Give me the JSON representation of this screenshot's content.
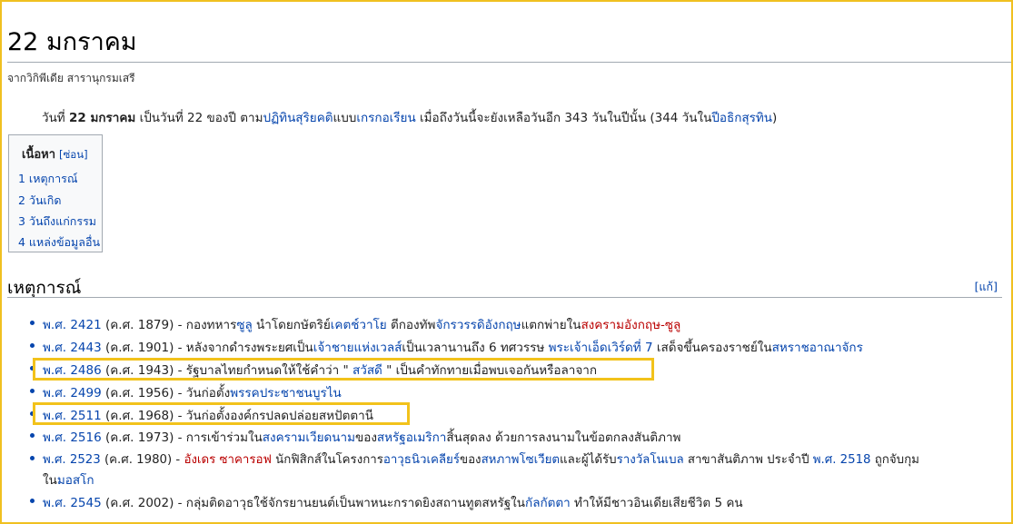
{
  "page": {
    "title": "22 มกราคม",
    "tagline": "จากวิกิพีเดีย สารานุกรมเสรี"
  },
  "intro": {
    "t1": "วันที่ ",
    "bold": "22 มกราคม",
    "t2": " เป็นวันที่ 22 ของปี ตาม",
    "link1": "ปฏิทินสุริยคติ",
    "t3": "แบบ",
    "link2": "เกรกอเรียน",
    "t4": " เมื่อถึงวันนี้จะยังเหลือวันอีก 343 วันในปีนั้น (344 วันใน",
    "link3": "ปีอธิกสุรทิน",
    "t5": ")"
  },
  "toc": {
    "title": "เนื้อหา",
    "hide": "[ซ่อน]",
    "items": [
      "1 เหตุการณ์",
      "2 วันเกิด",
      "3 วันถึงแก่กรรม",
      "4 แหล่งข้อมูลอื่น"
    ]
  },
  "section": {
    "heading": "เหตุการณ์",
    "edit": "[แก้]"
  },
  "events": [
    {
      "year": "พ.ศ. 2421",
      "ce": " (ค.ศ. 1879) - กองทหาร",
      "l1": "ซูลู",
      "a": " นำโดยกษัตริย์",
      "l2": "เคตช์วาโย",
      "b": " ตีกองทัพ",
      "l3": "จักรวรรดิอังกฤษ",
      "c": "แตกพ่ายใน",
      "r1": "สงครามอังกฤษ-ซูลู"
    },
    {
      "year": "พ.ศ. 2443",
      "ce": " (ค.ศ. 1901) - หลังจากดำรงพระยศเป็น",
      "l1": "เจ้าชายแห่งเวลส์",
      "a": "เป็นเวลานานถึง 6 ทศวรรษ ",
      "l2": "พระเจ้าเอ็ดเวิร์ดที่ 7",
      "b": " เสด็จขึ้นครองราชย์ใน",
      "l3": "สหราชอาณาจักร"
    },
    {
      "year": "พ.ศ. 2486",
      "ce": " (ค.ศ. 1943) - รัฐบาลไทยกำหนดให้ใช้คำว่า \" ",
      "l1": "สวัสดี",
      "a": " \" เป็นคำทักทายเมื่อพบเจอกันหรือลาจาก"
    },
    {
      "year": "พ.ศ. 2499",
      "ce": " (ค.ศ. 1956) - วันก่อตั้ง",
      "l1": "พรรคประชาชนบุรีไม",
      "l1_display": "พรรคประชาชน",
      "a": "บูรไน"
    },
    {
      "year": "พ.ศ. 2511",
      "ce": " (ค.ศ. 1968) - วันก่อตั้งองค์กรปลดปล่อยสหปัตตานี"
    },
    {
      "year": "พ.ศ. 2516",
      "ce": " (ค.ศ. 1973) - การเข้าร่วมใน",
      "l1": "สงครามเวียดนาม",
      "a": "ของ",
      "l2": "สหรัฐอเมริกา",
      "b": "สิ้นสุดลง ด้วยการลงนามในข้อตกลงสันติภาพ"
    },
    {
      "year": "พ.ศ. 2523",
      "ce": " (ค.ศ. 1980) - ",
      "r1": "อังเดร ซาคารอฟ",
      "a": " นักฟิสิกส์ในโครงการ",
      "l1": "อาวุธนิวเคลียร์",
      "b": "ของ",
      "l2": "สหภาพโซเวียต",
      "c": "และผู้ได้รับ",
      "l3": "รางวัลโนเบล",
      "d": " สาขาสันติภาพ ประจำปี ",
      "l4": "พ.ศ. 2518",
      "e": " ถูกจับกุม",
      "line2a": "ใน",
      "line2l": "มอสโก"
    },
    {
      "year": "พ.ศ. 2545",
      "ce": " (ค.ศ. 2002) - กลุ่มติดอาวุธใช้จักรยานยนต์เป็นพาหนะกราดยิงสถานทูตสหรัฐใน",
      "l1": "กัลกัตตา",
      "a": " ทำให้มีชาวอินเดียเสียชีวิต 5 คน"
    }
  ]
}
